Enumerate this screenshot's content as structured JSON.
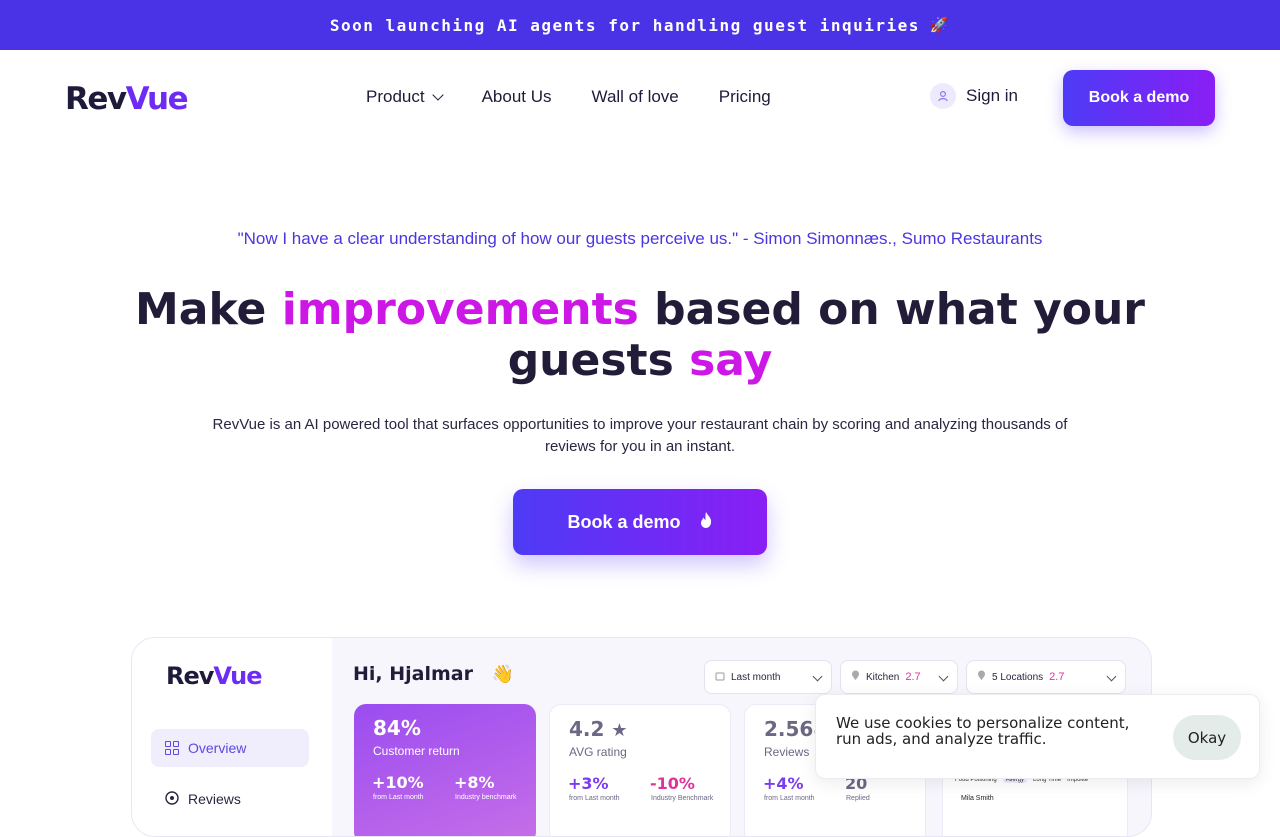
{
  "banner": {
    "text": "Soon launching AI agents for handling guest inquiries",
    "icon": "rocket-icon"
  },
  "nav": {
    "logo": {
      "part1": "Rev",
      "part2": "Vue"
    },
    "links": [
      "Product",
      "About Us",
      "Wall of love",
      "Pricing"
    ],
    "signin": "Sign in",
    "cta": "Book a demo"
  },
  "hero": {
    "quote": "\"Now I have a clear understanding of how our guests perceive us.\" - Simon Simonnæs., Sumo Restaurants",
    "headline": {
      "w1": "Make ",
      "h1": "improvements",
      "w2": " based on what your",
      "w3": "guests ",
      "h2": "say"
    },
    "sub": "RevVue is an AI powered tool that surfaces opportunities to improve your restaurant chain by scoring and analyzing thousands of reviews for you in an instant.",
    "cta": "Book a demo"
  },
  "dashboard": {
    "logo": {
      "part1": "Rev",
      "part2": "Vue"
    },
    "greeting": "Hi, Hjalmar",
    "wave": "👋",
    "sidebar": [
      {
        "label": "Overview"
      },
      {
        "label": "Reviews"
      }
    ],
    "filters": [
      {
        "label": "Last month",
        "value": ""
      },
      {
        "label": "Kitchen",
        "value": "2.7"
      },
      {
        "label": "5 Locations",
        "value": "2.7"
      }
    ],
    "cards": [
      {
        "big": "84%",
        "label": "Customer return",
        "d1": "+10%",
        "s1": "from Last month",
        "d2": "+8%",
        "s2": "Industry benchmark"
      },
      {
        "big": "4.2",
        "label": "AVG rating",
        "d1": "+3%",
        "s1": "from Last month",
        "d2": "-10%",
        "s2": "Industry Benchmark"
      },
      {
        "big": "2.568",
        "label": "Reviews",
        "d1": "+4%",
        "s1": "from Last month",
        "d2": "20",
        "s2": "Replied"
      }
    ],
    "tags": [
      "Food Poisoning",
      "Allergy",
      "Long Time",
      "Impolite"
    ],
    "reviewer": "Mila Smith"
  },
  "cookie": {
    "text": "We use cookies to personalize content, run ads, and analyze traffic.",
    "button": "Okay"
  },
  "colors": {
    "brand": "#4a33e6",
    "accent_pink": "#cc17e6",
    "gradient_start": "#4d3bf6",
    "gradient_end": "#8a1ef5"
  }
}
